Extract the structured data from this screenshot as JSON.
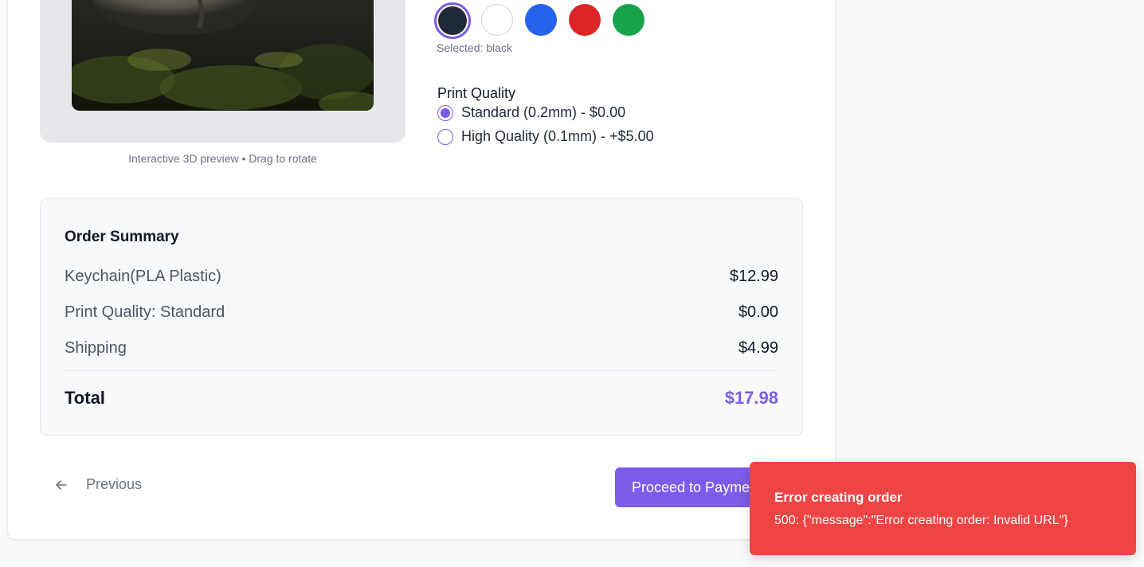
{
  "preview": {
    "caption": "Interactive 3D preview • Drag to rotate"
  },
  "colors": {
    "options": [
      {
        "name": "black",
        "hex": "#1f2937",
        "selected": true
      },
      {
        "name": "white",
        "hex": "#ffffff",
        "selected": false
      },
      {
        "name": "blue",
        "hex": "#2563eb",
        "selected": false
      },
      {
        "name": "red",
        "hex": "#dc2626",
        "selected": false
      },
      {
        "name": "green",
        "hex": "#16a34a",
        "selected": false
      }
    ],
    "selected_text": "Selected: black"
  },
  "print_quality": {
    "label": "Print Quality",
    "options": [
      {
        "label": "Standard (0.2mm) - $0.00",
        "selected": true
      },
      {
        "label": "High Quality (0.1mm) - +$5.00",
        "selected": false
      }
    ]
  },
  "order_summary": {
    "title": "Order Summary",
    "lines": [
      {
        "label": "Keychain(PLA Plastic)",
        "value": "$12.99"
      },
      {
        "label": "Print Quality: Standard",
        "value": "$0.00"
      },
      {
        "label": "Shipping",
        "value": "$4.99"
      }
    ],
    "total_label": "Total",
    "total_value": "$17.98"
  },
  "nav": {
    "previous_label": "Previous",
    "proceed_label": "Proceed to Payment"
  },
  "toast": {
    "title": "Error creating order",
    "message": "500: {\"message\":\"Error creating order: Invalid URL\"}"
  },
  "theme": {
    "accent": "#7c5ce8",
    "error": "#ef4444"
  }
}
